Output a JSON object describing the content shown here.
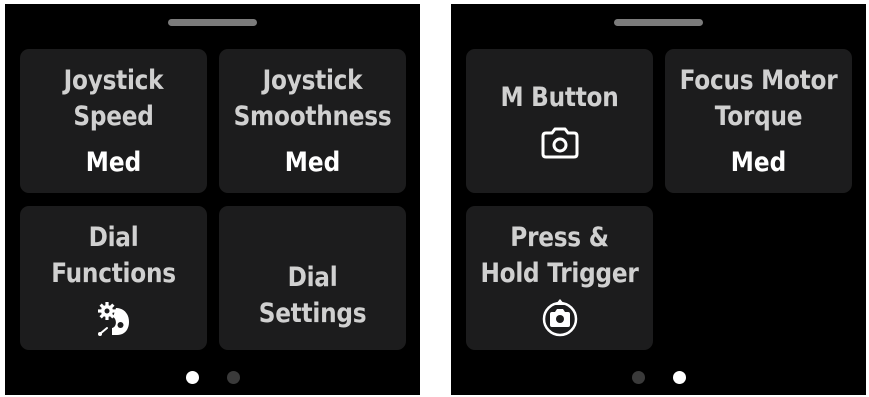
{
  "screens": [
    {
      "tiles": [
        {
          "title": "Joystick\nSpeed",
          "value": "Med"
        },
        {
          "title": "Joystick\nSmoothness",
          "value": "Med"
        },
        {
          "title": "Dial\nFunctions",
          "icon": "dial-gear-icon"
        },
        {
          "title": "Dial Settings"
        }
      ],
      "page_index": 1,
      "page_count": 2
    },
    {
      "tiles": [
        {
          "title": "M Button",
          "icon": "camera-icon"
        },
        {
          "title": "Focus Motor\nTorque",
          "value": "Med"
        },
        {
          "title": "Press &\nHold Trigger",
          "icon": "camera-rotate-icon"
        }
      ],
      "page_index": 2,
      "page_count": 2
    }
  ],
  "colors": {
    "background": "#000000",
    "tile": "#1c1c1d",
    "title_text": "#d0d0d0",
    "value_text": "#ffffff",
    "dot_active": "#ffffff",
    "dot_inactive": "#3a3a3a"
  }
}
